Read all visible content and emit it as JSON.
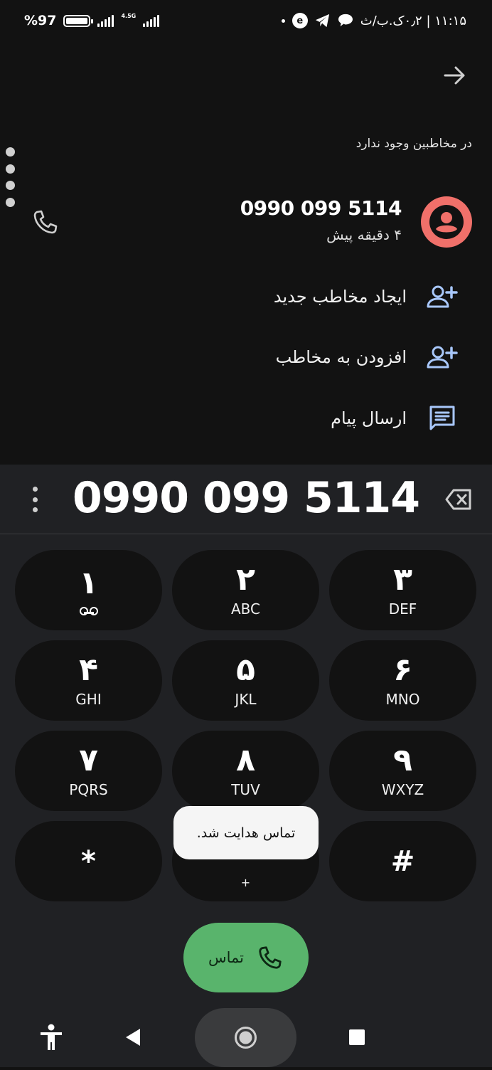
{
  "status_bar": {
    "battery_percent": "%97",
    "battery_level": 0.97,
    "network_type": "4.5G",
    "time_and_carrier": "۱۱:۱۵ | ۰٫۲ک.ب/ث"
  },
  "recent_call": {
    "not_in_contacts": "در مخاطبین وجود ندارد",
    "number": "0990 099 5114",
    "time_ago": "۴ دقیقه پیش"
  },
  "actions": [
    {
      "label": "ایجاد مخاطب جدید",
      "icon": "person-add-icon"
    },
    {
      "label": "افزودن به مخاطب",
      "icon": "person-add-icon"
    },
    {
      "label": "ارسال پیام",
      "icon": "message-icon"
    }
  ],
  "dialer": {
    "entered_number": "0990 099 5114",
    "keys": [
      {
        "digit": "۱",
        "letters": ""
      },
      {
        "digit": "۲",
        "letters": "ABC"
      },
      {
        "digit": "۳",
        "letters": "DEF"
      },
      {
        "digit": "۴",
        "letters": "GHI"
      },
      {
        "digit": "۵",
        "letters": "JKL"
      },
      {
        "digit": "۶",
        "letters": "MNO"
      },
      {
        "digit": "۷",
        "letters": "PQRS"
      },
      {
        "digit": "۸",
        "letters": "TUV"
      },
      {
        "digit": "۹",
        "letters": "WXYZ"
      },
      {
        "digit": "*",
        "letters": ""
      },
      {
        "digit": "",
        "letters": "+"
      },
      {
        "digit": "#",
        "letters": ""
      }
    ],
    "call_button_label": "تماس"
  },
  "toast": {
    "message": "تماس هدایت شد."
  },
  "colors": {
    "background": "#121212",
    "dialer_background": "#202124",
    "accent_blue": "#a8c7fa",
    "avatar": "#f0706a",
    "call_green": "#59b46c"
  }
}
